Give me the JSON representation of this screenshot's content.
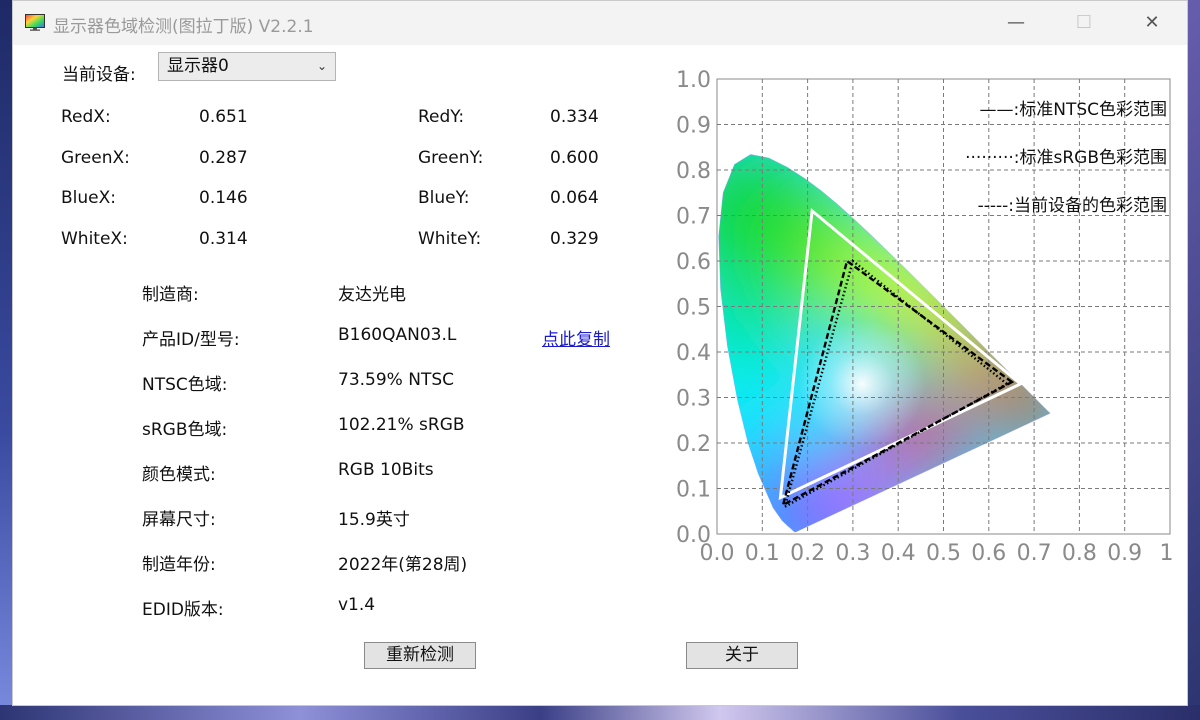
{
  "window": {
    "title": "显示器色域检测(图拉丁版) V2.2.1",
    "min_glyph": "—",
    "max_glyph": "☐",
    "close_glyph": "✕"
  },
  "device": {
    "label": "当前设备:",
    "selected": "显示器0"
  },
  "chromaticity": {
    "red_x_label": "RedX:",
    "red_x": "0.651",
    "red_y_label": "RedY:",
    "red_y": "0.334",
    "green_x_label": "GreenX:",
    "green_x": "0.287",
    "green_y_label": "GreenY:",
    "green_y": "0.600",
    "blue_x_label": "BlueX:",
    "blue_x": "0.146",
    "blue_y_label": "BlueY:",
    "blue_y": "0.064",
    "white_x_label": "WhiteX:",
    "white_x": "0.314",
    "white_y_label": "WhiteY:",
    "white_y": "0.329"
  },
  "info": {
    "manufacturer_label": "制造商:",
    "manufacturer": "友达光电",
    "product_label": "产品ID/型号:",
    "product": "B160QAN03.L",
    "copy_link": "点此复制",
    "ntsc_label": "NTSC色域:",
    "ntsc": "73.59% NTSC",
    "srgb_label": "sRGB色域:",
    "srgb": "102.21% sRGB",
    "color_mode_label": "颜色模式:",
    "color_mode": "RGB 10Bits",
    "screen_size_label": "屏幕尺寸:",
    "screen_size": "15.9英寸",
    "year_label": "制造年份:",
    "year": "2022年(第28周)",
    "edid_label": "EDID版本:",
    "edid": "v1.4"
  },
  "buttons": {
    "redetect": "重新检测",
    "about": "关于"
  },
  "chart_data": {
    "type": "scatter",
    "xlim": [
      0,
      1
    ],
    "ylim": [
      0,
      1
    ],
    "x_ticks": [
      "0.0",
      "0.1",
      "0.2",
      "0.3",
      "0.4",
      "0.5",
      "0.6",
      "0.7",
      "0.8",
      "0.9",
      "1."
    ],
    "y_ticks": [
      "0.0",
      "0.1",
      "0.2",
      "0.3",
      "0.4",
      "0.5",
      "0.6",
      "0.7",
      "0.8",
      "0.9",
      "1.0"
    ],
    "grid": true,
    "legend_position": "top-right",
    "series": [
      {
        "name": "标准NTSC色彩范围",
        "legend": "——:标准NTSC色彩范围",
        "style": "solid",
        "color": "#ffffff",
        "points": [
          [
            0.67,
            0.33
          ],
          [
            0.21,
            0.71
          ],
          [
            0.14,
            0.08
          ]
        ]
      },
      {
        "name": "标准sRGB色彩范围",
        "legend": "·········:标准sRGB色彩范围",
        "style": "dotted",
        "color": "#000000",
        "points": [
          [
            0.64,
            0.33
          ],
          [
            0.3,
            0.6
          ],
          [
            0.15,
            0.06
          ]
        ]
      },
      {
        "name": "当前设备的色彩范围",
        "legend": "-----:当前设备的色彩范围",
        "style": "dashed",
        "color": "#000000",
        "points": [
          [
            0.651,
            0.334
          ],
          [
            0.287,
            0.6
          ],
          [
            0.146,
            0.064
          ]
        ]
      }
    ]
  }
}
